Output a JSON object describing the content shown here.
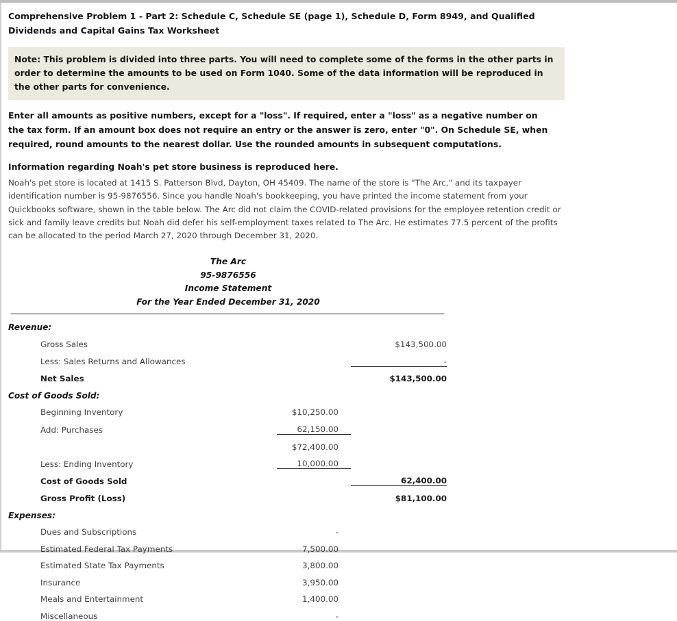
{
  "document": {
    "title": "Comprehensive Problem 1 - Part 2: Schedule C, Schedule SE (page 1), Schedule D, Form 8949, and Qualified Dividends and Capital Gains Tax Worksheet",
    "note": "Note: This problem is divided into three parts. You will need to complete some of the forms in the other parts in order to determine the amounts to be used on Form 1040. Some of the data information will be reproduced in the other parts for convenience.",
    "instructions": "Enter all amounts as positive numbers, except for a \"loss\". If required, enter a \"loss\" as a negative number on the tax form. If an amount box does not require an entry or the answer is zero, enter \"0\". On Schedule SE, when required, round amounts to the nearest dollar. Use the rounded amounts in subsequent computations.",
    "info_heading": "Information regarding Noah's pet store business is reproduced here.",
    "info_body": "Noah's pet store is located at 1415 S. Patterson Blvd, Dayton, OH 45409. The name of the store is \"The Arc,\" and its taxpayer identification number is 95-9876556. Since you handle Noah's bookkeeping, you have printed the income statement from your Quickbooks software, shown in the table below. The Arc did not claim the COVID-related provisions for the employee retention credit or sick and family leave credits but Noah did defer his self-employment taxes related to The Arc. He estimates 77.5 percent of the profits can be allocated to the period March 27, 2020 through December 31, 2020."
  },
  "statement": {
    "company": "The Arc",
    "ein": "95-9876556",
    "report_name": "Income Statement",
    "period": "For the Year Ended December 31, 2020",
    "rows": [
      {
        "label": "Revenue:",
        "mid": "",
        "right": ""
      },
      {
        "label": "Gross Sales",
        "mid": "",
        "right": "$143,500.00"
      },
      {
        "label": "Less: Sales Returns and Allowances",
        "mid": "",
        "right": "-"
      },
      {
        "label": "Net Sales",
        "mid": "",
        "right": "$143,500.00"
      },
      {
        "label": "Cost of Goods Sold:",
        "mid": "",
        "right": ""
      },
      {
        "label": "Beginning Inventory",
        "mid": "$10,250.00",
        "right": ""
      },
      {
        "label": "Add: Purchases",
        "mid": "62,150.00",
        "right": ""
      },
      {
        "label": "",
        "mid": "$72,400.00",
        "right": ""
      },
      {
        "label": "Less: Ending Inventory",
        "mid": "10,000.00",
        "right": ""
      },
      {
        "label": "Cost of Goods Sold",
        "mid": "",
        "right": "62,400.00"
      },
      {
        "label": "Gross Profit (Loss)",
        "mid": "",
        "right": "$81,100.00"
      },
      {
        "label": "Expenses:",
        "mid": "",
        "right": ""
      },
      {
        "label": "Dues and Subscriptions",
        "mid": "-",
        "right": ""
      },
      {
        "label": "Estimated Federal Tax Payments",
        "mid": "7,500.00",
        "right": ""
      },
      {
        "label": "Estimated State Tax Payments",
        "mid": "3,800.00",
        "right": ""
      },
      {
        "label": "Insurance",
        "mid": "3,950.00",
        "right": ""
      },
      {
        "label": "Meals and Entertainment",
        "mid": "1,400.00",
        "right": ""
      },
      {
        "label": "Miscellaneous",
        "mid": "-",
        "right": ""
      }
    ]
  },
  "colors": {
    "note_background": "#eceade",
    "rule": "#2b2b2b",
    "chrome": "#bdbdbd",
    "body_text": "#3f3f3f",
    "heading_text": "#161616"
  }
}
